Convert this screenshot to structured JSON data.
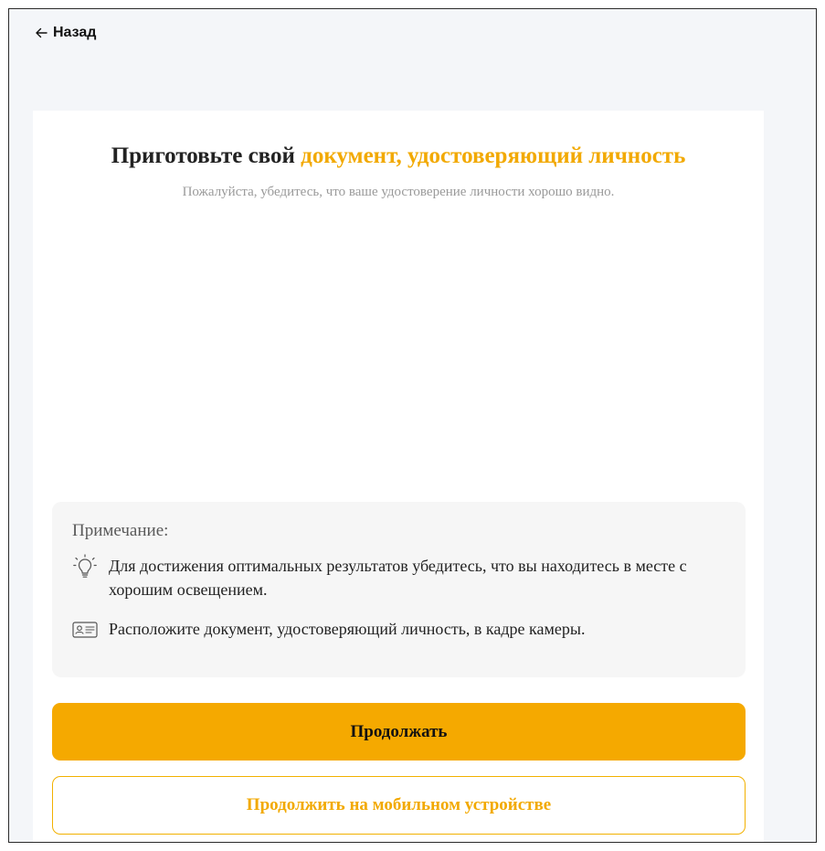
{
  "nav": {
    "back_label": "Назад"
  },
  "header": {
    "title_prefix": "Приготовьте свой ",
    "title_accent": "документ, удостоверяющий личность",
    "subtitle": "Пожалуйста, убедитесь, что ваше удостоверение личности хорошо видно."
  },
  "note": {
    "heading": "Примечание:",
    "items": [
      {
        "icon": "lightbulb-icon",
        "text": "Для достижения оптимальных результатов убедитесь, что вы находитесь в месте с хорошим освещением."
      },
      {
        "icon": "id-card-icon",
        "text": "Расположите документ, удостоверяющий личность, в кадре камеры."
      }
    ]
  },
  "actions": {
    "continue_label": "Продолжать",
    "continue_mobile_label": "Продолжить на мобильном устройстве"
  },
  "colors": {
    "accent": "#f5a900",
    "background": "#f4f6f9",
    "note_background": "#f6f6f6"
  }
}
